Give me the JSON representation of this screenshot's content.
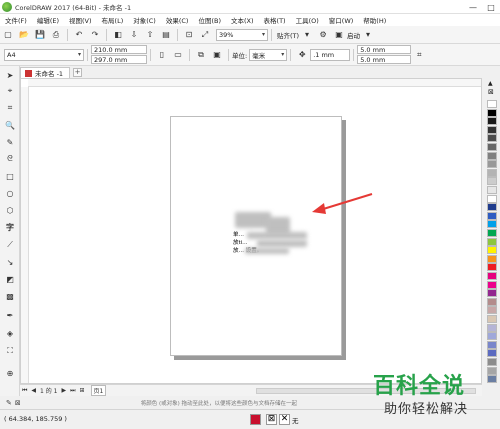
{
  "window": {
    "title": "CorelDRAW 2017 (64-Bit) - 未命名 -1",
    "minimize": "—",
    "maximize": "□"
  },
  "menu": [
    "文件(F)",
    "编辑(E)",
    "视图(V)",
    "布局(L)",
    "对象(C)",
    "效果(C)",
    "位图(B)",
    "文本(X)",
    "表格(T)",
    "工具(O)",
    "窗口(W)",
    "帮助(H)"
  ],
  "toolbar": {
    "zoom": "39%",
    "snap_label": "贴齐(T)",
    "launch_label": "启动"
  },
  "propbar": {
    "page_size": "A4",
    "width": "210.0 mm",
    "height": "297.0 mm",
    "unit_label": "单位:",
    "unit": "毫米",
    "nudge": ".1 mm",
    "dup_x": "5.0 mm",
    "dup_y": "5.0 mm"
  },
  "tabs": {
    "doc_tab": "未命名 -1",
    "add": "+"
  },
  "document": {
    "line1": "单…",
    "line2": "放ti…",
    "line3": "放…                          设置。"
  },
  "pagebar": {
    "page_info": "1 的 1",
    "page_tab": "页1"
  },
  "infobar": {
    "hint": "将颜色 (或对象) 拖动至此处，以便将这些颜色与文档存储在一起"
  },
  "status": {
    "coordinates": "( 64.384, 185.759 )",
    "fill_none": "无"
  },
  "watermark": {
    "title": "百科全说",
    "subtitle": "助你轻松解决"
  },
  "colors": {
    "palette": [
      "#ffffff",
      "#000000",
      "#1a1a1a",
      "#333333",
      "#4d4d4d",
      "#666666",
      "#808080",
      "#999999",
      "#b3b3b3",
      "#cccccc",
      "#e6e6e6",
      "#ffffff",
      "#1f3b8c",
      "#2e5cc2",
      "#00a0e9",
      "#00a651",
      "#8dc63f",
      "#fff200",
      "#f7941d",
      "#ed1c24",
      "#e6007e",
      "#ec008c",
      "#92278f",
      "#b38c8c",
      "#c8a8a8",
      "#d9c7b3",
      "#b5b5d6",
      "#9fa8da",
      "#7986cb",
      "#5c6bc0",
      "#8c8c8c",
      "#a6a6a6",
      "#6b7fa3"
    ]
  }
}
